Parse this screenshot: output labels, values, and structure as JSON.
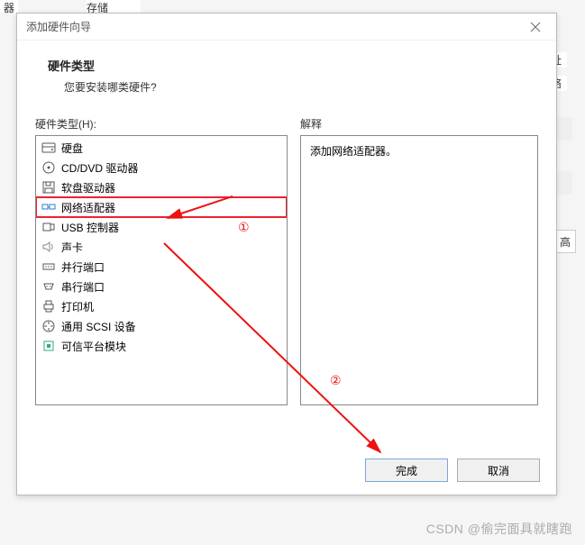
{
  "bg": {
    "tab1": "器",
    "tab2": "存储",
    "label1": "址",
    "label2": "络",
    "btn_frag": "高"
  },
  "dialog": {
    "title": "添加硬件向导",
    "header": {
      "title": "硬件类型",
      "subtitle": "您要安装哪类硬件?"
    },
    "left_label": "硬件类型(H):",
    "right_label": "解释",
    "description": "添加网络适配器。",
    "items": [
      {
        "id": "hdd",
        "label": "硬盘",
        "selected": false
      },
      {
        "id": "cddvd",
        "label": "CD/DVD 驱动器",
        "selected": false
      },
      {
        "id": "floppy",
        "label": "软盘驱动器",
        "selected": false
      },
      {
        "id": "net",
        "label": "网络适配器",
        "selected": true
      },
      {
        "id": "usb",
        "label": "USB 控制器",
        "selected": false
      },
      {
        "id": "sound",
        "label": "声卡",
        "selected": false
      },
      {
        "id": "parallel",
        "label": "并行端口",
        "selected": false
      },
      {
        "id": "serial",
        "label": "串行端口",
        "selected": false
      },
      {
        "id": "printer",
        "label": "打印机",
        "selected": false
      },
      {
        "id": "scsi",
        "label": "通用 SCSI 设备",
        "selected": false
      },
      {
        "id": "tpm",
        "label": "可信平台模块",
        "selected": false
      }
    ],
    "footer": {
      "finish": "完成",
      "cancel": "取消"
    }
  },
  "annotations": {
    "step1": "①",
    "step2": "②"
  },
  "watermark": "CSDN @偷完面具就瞎跑"
}
